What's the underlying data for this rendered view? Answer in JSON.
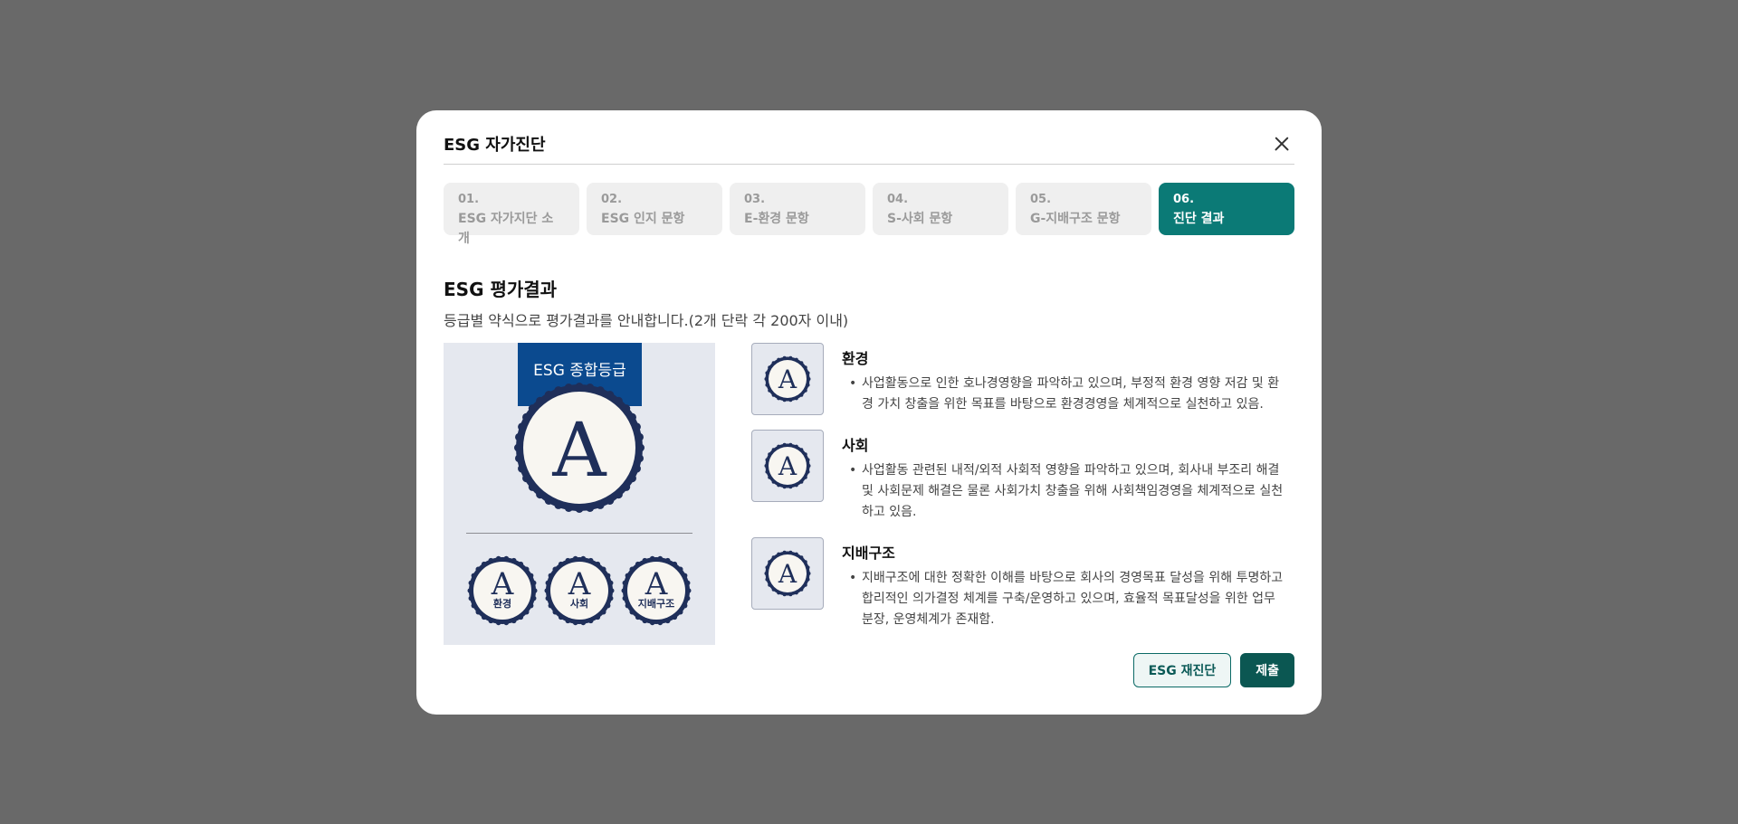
{
  "modal": {
    "title": "ESG 자가진단",
    "close_icon": "close-icon"
  },
  "steps": [
    {
      "num": "01.",
      "label": "ESG 자가지단 소개",
      "active": false
    },
    {
      "num": "02.",
      "label": "ESG 인지 문항",
      "active": false
    },
    {
      "num": "03.",
      "label": "E-환경 문항",
      "active": false
    },
    {
      "num": "04.",
      "label": "S-사회 문항",
      "active": false
    },
    {
      "num": "05.",
      "label": "G-지배구조 문항",
      "active": false
    },
    {
      "num": "06.",
      "label": "진단 결과",
      "active": true
    }
  ],
  "result": {
    "title": "ESG 평가결과",
    "description": "등급별 약식으로 평가결과를 안내합니다.(2개 단락 각 200자 이내)",
    "overall": {
      "banner": "ESG 종합등급",
      "grade": "A"
    },
    "sub_grades": [
      {
        "grade": "A",
        "label": "환경"
      },
      {
        "grade": "A",
        "label": "사회"
      },
      {
        "grade": "A",
        "label": "지배구조"
      }
    ],
    "items": [
      {
        "grade": "A",
        "title": "환경",
        "bullet": "•",
        "text": "사업활동으로 인한 호나경영향을 파악하고 있으며, 부정적 환경 영향 저감 및 환경 가치 창출을 위한 목표를 바탕으로 환경경영을 체계적으로 실천하고 있음."
      },
      {
        "grade": "A",
        "title": "사회",
        "bullet": "•",
        "text": "사업활동 관련된 내적/외적 사회적 영향을 파악하고 있으며, 회사내 부조리 해결 및 사회문제 해결은 물론 사회가치 창출을 위해 사회책임경영을 체계적으로 실천하고 있음."
      },
      {
        "grade": "A",
        "title": "지배구조",
        "bullet": "•",
        "text": "지배구조에 대한 정확한 이해를 바탕으로 회사의 경영목표 달성을 위해 투명하고 합리적인 의가결정 체계를 구축/운영하고 있으며, 효율적 목표달성을 위한 업무 분장, 운영체계가 존재함."
      }
    ]
  },
  "footer": {
    "retry_label": "ESG 재진단",
    "submit_label": "제출"
  },
  "colors": {
    "accent": "#0b7a76",
    "badge": "#1f2f5a",
    "banner": "#0b4a8f"
  }
}
